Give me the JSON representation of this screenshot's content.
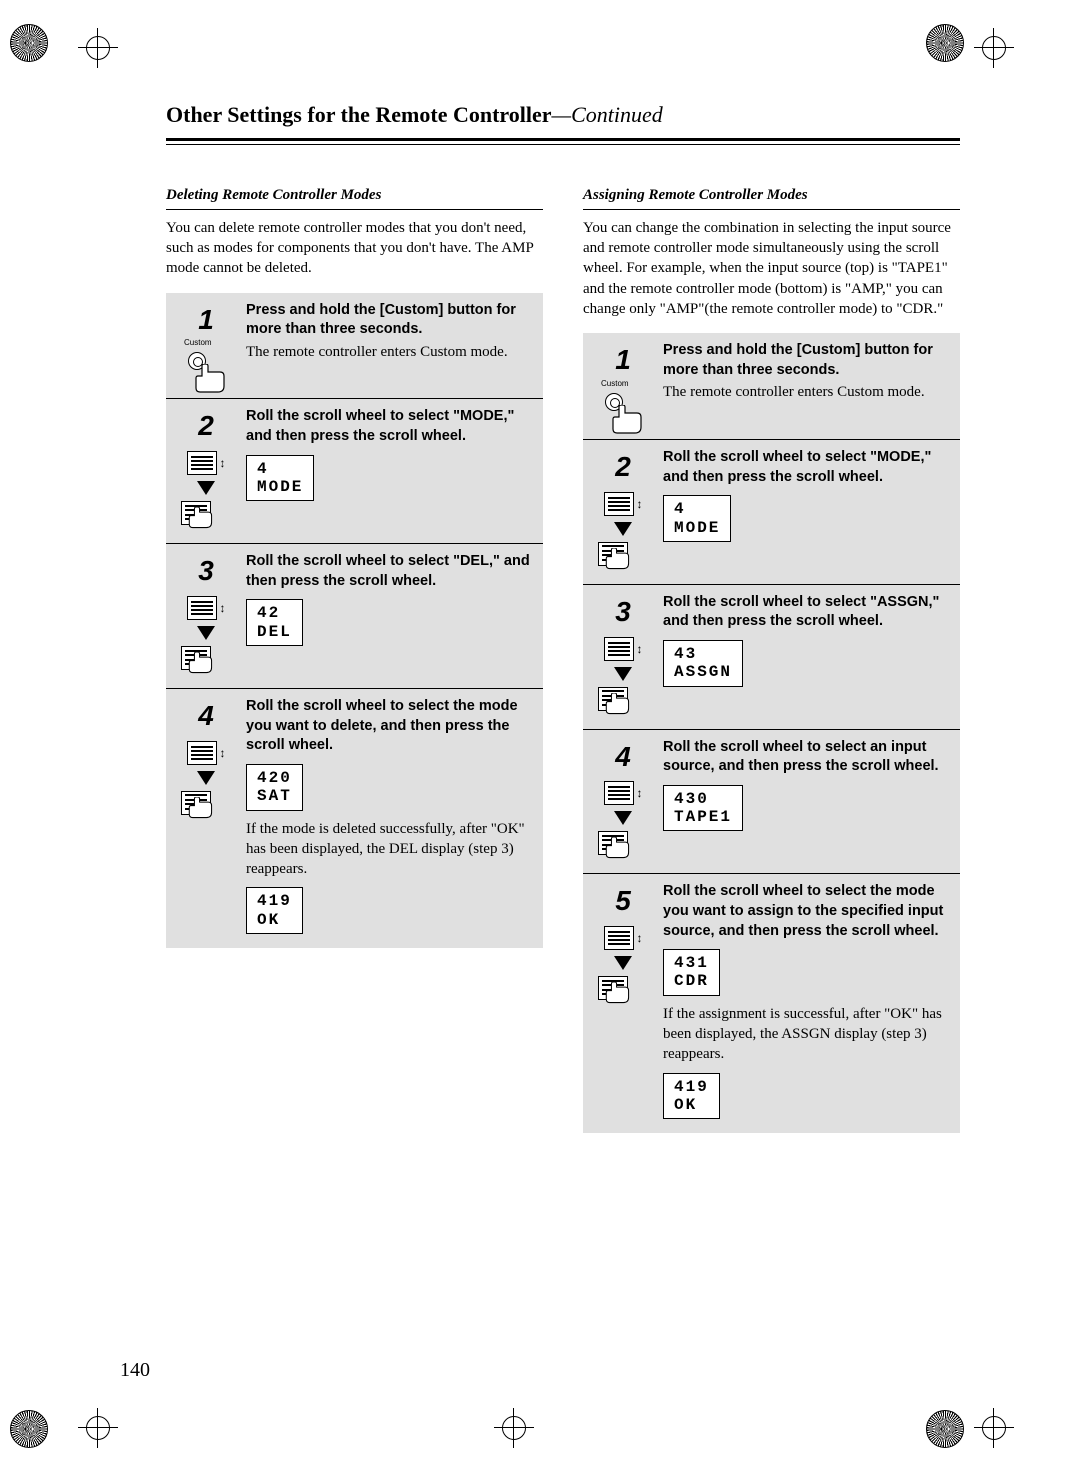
{
  "page_title_main": "Other Settings for the Remote Controller",
  "page_title_cont": "—Continued",
  "page_number": "140",
  "left": {
    "subtitle": "Deleting Remote Controller Modes",
    "intro": "You can delete remote controller modes that you don't need, such as modes for components that you don't have. The AMP mode cannot be deleted.",
    "custom_label": "Custom",
    "steps": [
      {
        "num": "1",
        "bold": "Press and hold the [Custom] button for more than three seconds.",
        "text": "The remote controller enters Custom mode."
      },
      {
        "num": "2",
        "bold": "Roll the scroll wheel to select \"MODE,\" and then press the scroll wheel.",
        "lcd": "4\nMODE"
      },
      {
        "num": "3",
        "bold": "Roll the scroll wheel to select \"DEL,\" and then press the scroll wheel.",
        "lcd": "42\nDEL"
      },
      {
        "num": "4",
        "bold": "Roll the scroll wheel to select the mode you want to delete, and then press the scroll wheel.",
        "lcd": "420\nSAT",
        "text2": "If the mode is deleted successfully, after \"OK\" has been displayed, the DEL display (step 3) reappears.",
        "lcd2": "419\nOK"
      }
    ]
  },
  "right": {
    "subtitle": "Assigning Remote Controller Modes",
    "intro": "You can change the combination in selecting the input source and remote controller mode simultaneously using the scroll wheel. For example, when the input source (top) is \"TAPE1\" and the remote controller mode (bottom) is \"AMP,\" you can change only \"AMP\"(the remote controller mode) to \"CDR.\"",
    "custom_label": "Custom",
    "steps": [
      {
        "num": "1",
        "bold": "Press and hold the [Custom] button for more than three seconds.",
        "text": "The remote controller enters Custom mode."
      },
      {
        "num": "2",
        "bold": "Roll the scroll wheel to select \"MODE,\" and then press the scroll wheel.",
        "lcd": "4\nMODE"
      },
      {
        "num": "3",
        "bold": "Roll the scroll wheel to select \"ASSGN,\" and then press the scroll wheel.",
        "lcd": "43\nASSGN"
      },
      {
        "num": "4",
        "bold": "Roll the scroll wheel to select an input source, and then press the scroll wheel.",
        "lcd": "430\nTAPE1"
      },
      {
        "num": "5",
        "bold": "Roll the scroll wheel to select the mode you want to assign to the specified input source, and then press the scroll wheel.",
        "lcd": "431\nCDR",
        "text2": "If the assignment is successful, after \"OK\" has been displayed, the ASSGN display (step 3) reappears.",
        "lcd2": "419\nOK"
      }
    ]
  }
}
